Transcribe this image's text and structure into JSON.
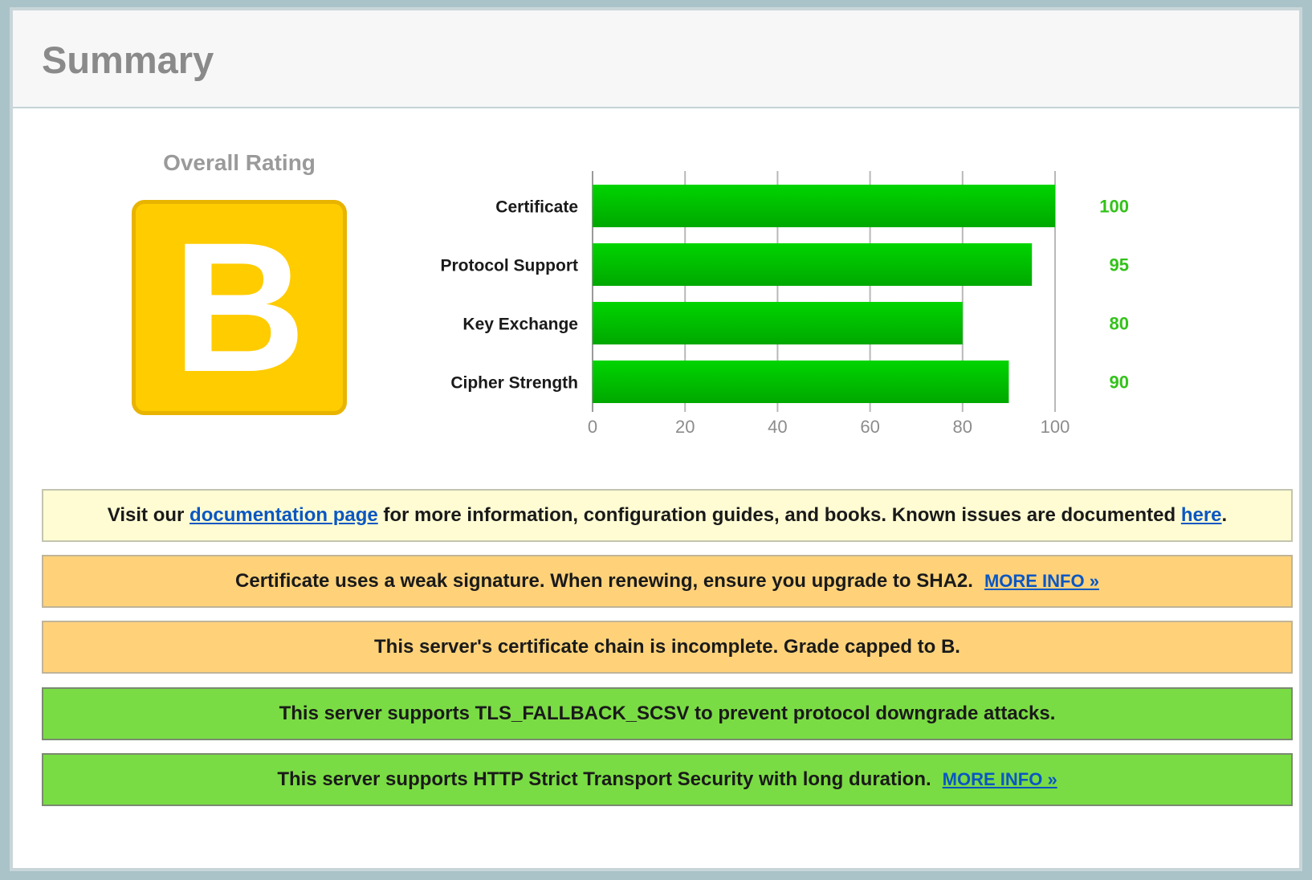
{
  "header": {
    "title": "Summary"
  },
  "rating": {
    "label": "Overall Rating",
    "grade": "B",
    "color": "#ffcc00"
  },
  "chart_data": {
    "type": "bar",
    "orientation": "horizontal",
    "categories": [
      "Certificate",
      "Protocol Support",
      "Key Exchange",
      "Cipher Strength"
    ],
    "values": [
      100,
      95,
      80,
      90
    ],
    "value_labels": [
      "100",
      "95",
      "80",
      "90"
    ],
    "xlim": [
      0,
      100
    ],
    "xticks": [
      0,
      20,
      40,
      60,
      80,
      100
    ],
    "grid": true,
    "bar_color": "#00c000",
    "value_label_color": "#33c21a"
  },
  "notices": [
    {
      "style": "info",
      "text_before": "Visit our ",
      "link1": "documentation page",
      "text_middle": " for more information, configuration guides, and books. Known issues are documented ",
      "link2": "here",
      "text_after": "."
    },
    {
      "style": "warn",
      "text": "Certificate uses a weak signature. When renewing, ensure you upgrade to SHA2.",
      "link": "MORE INFO »"
    },
    {
      "style": "warn",
      "text": "This server's certificate chain is incomplete. Grade capped to B."
    },
    {
      "style": "good",
      "text": "This server supports TLS_FALLBACK_SCSV to prevent protocol downgrade attacks."
    },
    {
      "style": "good",
      "text": "This server supports HTTP Strict Transport Security with long duration.",
      "link": "MORE INFO »"
    }
  ]
}
